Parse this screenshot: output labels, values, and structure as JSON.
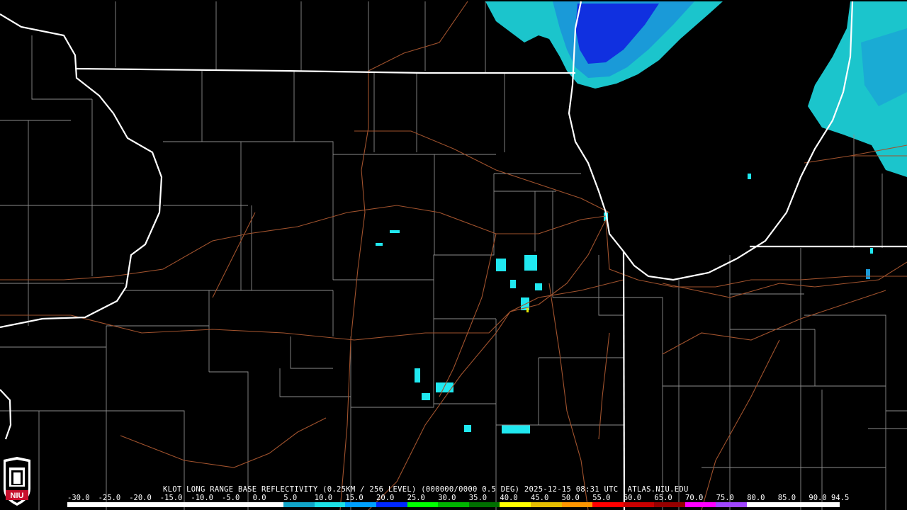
{
  "product": {
    "caption_parts": [
      "KLOT LONG RANGE BASE REFLECTIVITY",
      "(0.25KM / 256 LEVEL)",
      "(000000/0000 0.5 DEG)",
      "2025-12-15 08:31 UTC",
      "ATLAS.NIU.EDU"
    ]
  },
  "legend": {
    "labels": [
      "-30.0",
      "-25.0",
      "-20.0",
      "-15.0",
      "-10.0",
      "-5.0",
      "0.0",
      "5.0",
      "10.0",
      "15.0",
      "20.0",
      "25.0",
      "30.0",
      "35.0",
      "40.0",
      "45.0",
      "50.0",
      "55.0",
      "60.0",
      "65.0",
      "70.0",
      "75.0",
      "80.0",
      "85.0",
      "90.0",
      "94.5"
    ],
    "colors": [
      "#ffffff",
      "#ffffff",
      "#ffffff",
      "#ffffff",
      "#ffffff",
      "#ffffff",
      "#ffffff",
      "#11a5c8",
      "#1ce1e6",
      "#00a0ff",
      "#0028ff",
      "#00ff00",
      "#00b400",
      "#006e00",
      "#ffff00",
      "#e6be00",
      "#ff9600",
      "#ff0000",
      "#c80000",
      "#960000",
      "#ff00ff",
      "#a046ff",
      "#ffffff",
      "#ffffff",
      "#ffffff"
    ]
  },
  "logo": {
    "text": "NIU"
  },
  "colors": {
    "state_border": "#ffffff",
    "county_border": "#8c8c8c",
    "highway": "#a0522d",
    "light_echo": "#20e8f0",
    "mid_echo": "#1a9ad8",
    "strong_echo": "#1030e0"
  }
}
